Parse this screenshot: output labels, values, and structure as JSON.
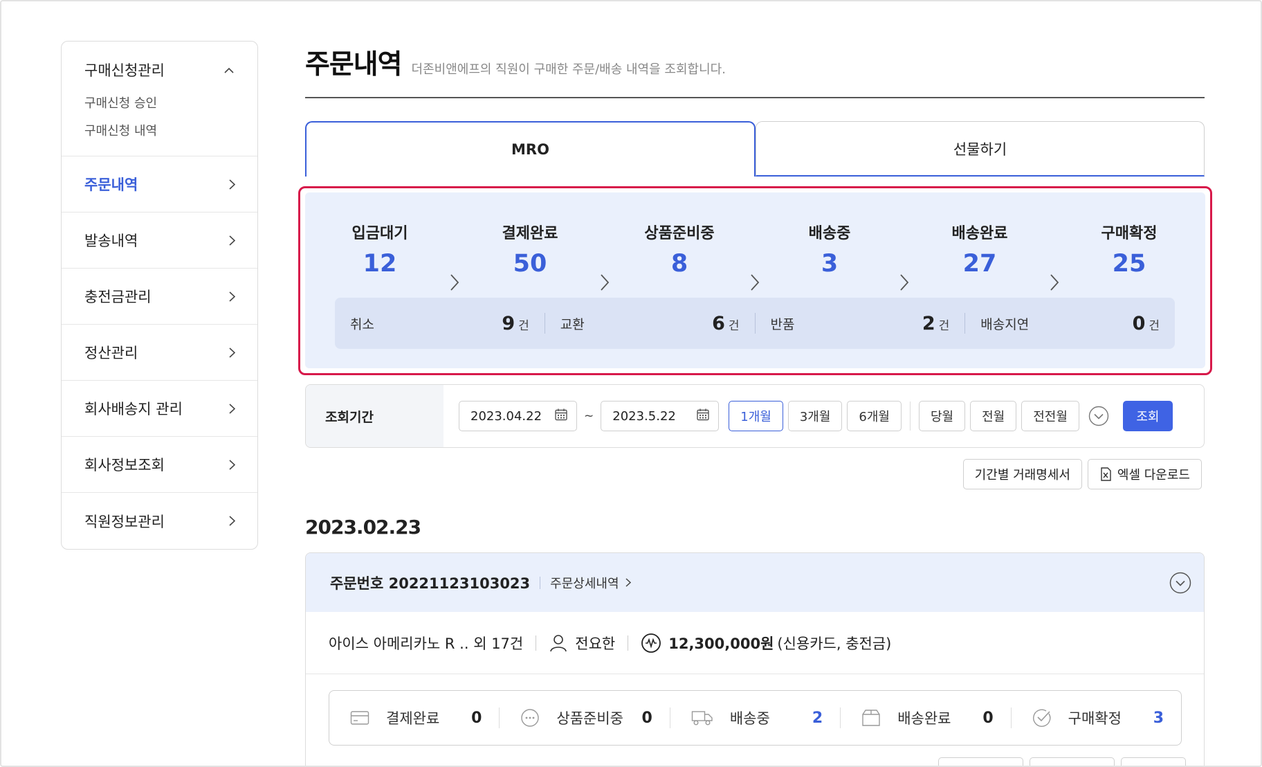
{
  "sidebar": {
    "group": {
      "title": "구매신청관리",
      "items": [
        "구매신청 승인",
        "구매신청 내역"
      ]
    },
    "items": [
      {
        "label": "주문내역",
        "active": true
      },
      {
        "label": "발송내역"
      },
      {
        "label": "충전금관리"
      },
      {
        "label": "정산관리"
      },
      {
        "label": "회사배송지 관리"
      },
      {
        "label": "회사정보조회"
      },
      {
        "label": "직원정보관리"
      }
    ]
  },
  "header": {
    "title": "주문내역",
    "description": "더존비앤에프의 직원이 구매한 주문/배송 내역을 조회합니다."
  },
  "tabs": [
    {
      "label": "MRO",
      "active": true
    },
    {
      "label": "선물하기"
    }
  ],
  "summary": {
    "steps": [
      {
        "label": "입금대기",
        "count": "12"
      },
      {
        "label": "결제완료",
        "count": "50"
      },
      {
        "label": "상품준비중",
        "count": "8"
      },
      {
        "label": "배송중",
        "count": "3"
      },
      {
        "label": "배송완료",
        "count": "27"
      },
      {
        "label": "구매확정",
        "count": "25"
      }
    ],
    "substats": [
      {
        "label": "취소",
        "value": "9",
        "unit": "건"
      },
      {
        "label": "교환",
        "value": "6",
        "unit": "건"
      },
      {
        "label": "반품",
        "value": "2",
        "unit": "건"
      },
      {
        "label": "배송지연",
        "value": "0",
        "unit": "건"
      }
    ]
  },
  "filter": {
    "label": "조회기간",
    "start_date": "2023.04.22",
    "separator": "~",
    "end_date": "2023.5.22",
    "periods": [
      "1개월",
      "3개월",
      "6개월"
    ],
    "months": [
      "당월",
      "전월",
      "전전월"
    ],
    "active_period": "1개월",
    "search_label": "조회"
  },
  "actions": {
    "statement": "기간별 거래명세서",
    "excel": "엑셀 다운로드"
  },
  "order": {
    "date": "2023.02.23",
    "number_label": "주문번호 20221123103023",
    "detail_label": "주문상세내역",
    "product": "아이스 아메리카노 R .. 외 17건",
    "user": "전요한",
    "amount": "12,300,000원",
    "payment": "(신용카드, 충전금)",
    "steps": [
      {
        "label": "결제완료",
        "value": "0",
        "icon": "card-icon"
      },
      {
        "label": "상품준비중",
        "value": "0",
        "icon": "ellipsis-icon"
      },
      {
        "label": "배송중",
        "value": "2",
        "icon": "truck-icon"
      },
      {
        "label": "배송완료",
        "value": "0",
        "icon": "box-icon"
      },
      {
        "label": "구매확정",
        "value": "3",
        "icon": "check-icon"
      }
    ]
  },
  "colors": {
    "accent": "#3a5fd9",
    "highlight": "#d7194a",
    "summary_bg": "#eaf0fc"
  }
}
